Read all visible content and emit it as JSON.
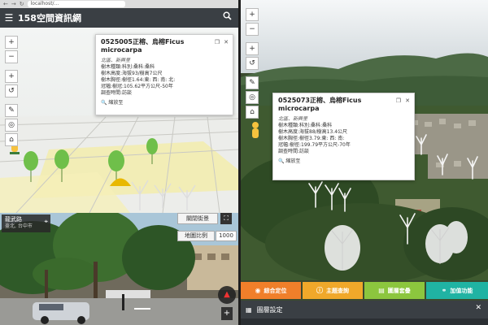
{
  "browser": {
    "url": "localhost/...",
    "nav_back": "←",
    "nav_fwd": "→",
    "nav_reload": "↻"
  },
  "header": {
    "title": "158空間資訊網",
    "menu_icon": "hamburger-icon",
    "search_icon": "search-icon"
  },
  "map_controls": {
    "zoom_in": "+",
    "zoom_out": "−",
    "add": "+",
    "rotate": "↺",
    "pen": "✎",
    "locate": "◎",
    "home": "⌂"
  },
  "popup_left": {
    "title": "0525005正榕、烏榕Ficus microcarpa",
    "subtitle": "北區、新興里",
    "lines": [
      "樹木種類:科別:桑科:桑科",
      "樹木高度:海拔93/樹高7公尺",
      "樹木胸徑:樹徑1.64:東: 西: 南: 北:",
      "冠幅:樹冠:105.62平方公尺-50年",
      "調查時間:訪談"
    ],
    "zoom_label": "縮放至"
  },
  "popup_right": {
    "title": "0525073正榕、烏榕Ficus microcarpa",
    "subtitle": "北區、新興里",
    "lines": [
      "樹木種類:科別:桑科:桑科",
      "樹木高度:海拔88/樹高13.4公尺",
      "樹木胸徑:樹徑3.79:東: 西: 南:",
      "冠幅:樹徑:199.79平方公尺-70年",
      "調查時間:訪談"
    ],
    "zoom_label": "縮放至"
  },
  "street_view": {
    "name": "龍武路",
    "city": "臺北, 台中市",
    "close_label": "關閉街景",
    "scale_label": "地圖比例",
    "scale_value": "1000",
    "zoom_plus": "+"
  },
  "function_buttons": [
    {
      "label": "綜合定位",
      "icon": "target-icon"
    },
    {
      "label": "主題查詢",
      "icon": "info-icon"
    },
    {
      "label": "圖層套疊",
      "icon": "layers-icon"
    },
    {
      "label": "加值功能",
      "icon": "share-icon"
    }
  ],
  "layer_settings": {
    "label": "圖層設定",
    "close": "✕"
  },
  "colors": {
    "header": "#3a3f44",
    "orange": "#f07f2a",
    "amber": "#f0a82a",
    "green": "#8cc63e",
    "teal": "#20b3a3"
  }
}
